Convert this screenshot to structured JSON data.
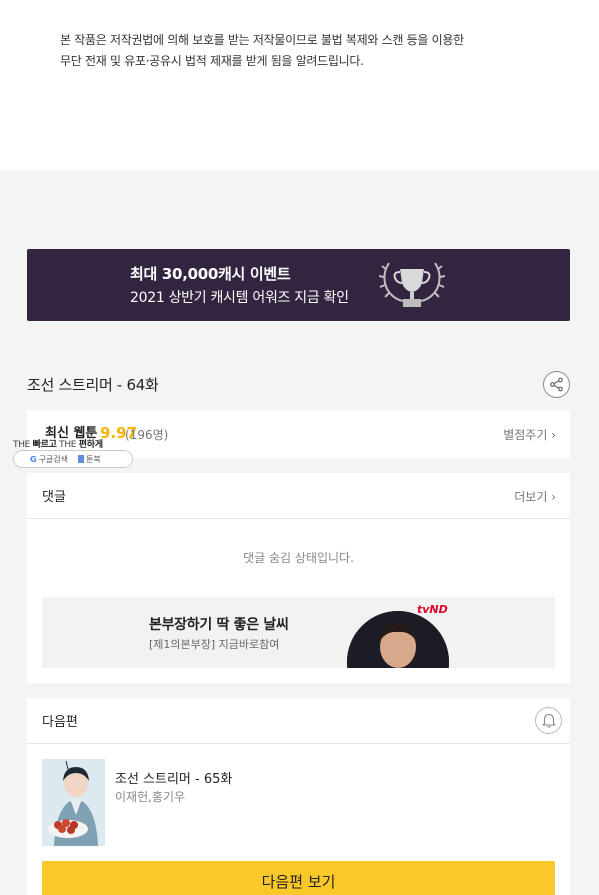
{
  "notice": {
    "line1": "본 작품은 저작권법에 의해 보호를 받는 저작물이므로 불법 복제와 스캔 등을 이용한",
    "line2": "무단 전재 및 유포·공유시 법적 제재를 받게 됨을 알려드립니다."
  },
  "banner": {
    "title": "최대 30,000캐시 이벤트",
    "subtitle": "2021 상반기 캐시템 어워즈 지금 확인",
    "background": "#33243f"
  },
  "episode": {
    "title": "조선 스트리머 - 64화"
  },
  "rating": {
    "label": "최신 웹툰",
    "score": "9.97",
    "count": "(196명)",
    "rate_link": "별점주기 ›"
  },
  "overlay_ad": {
    "text_prefix": "THE",
    "text_fast": "빠르고",
    "text_mid": "THE",
    "text_easy": "편하게",
    "google_label": "구글검색",
    "book_label": "툰북"
  },
  "comments": {
    "header": "댓글",
    "more_link": "더보기 ›",
    "hidden_message": "댓글 숨김 상태입니다.",
    "promo_title": "본부장하기 딱 좋은 날씨",
    "promo_subtitle": "[제1의본부장] 지금바로참여",
    "promo_logo": "tvND"
  },
  "next_episode": {
    "header": "다음편",
    "title": "조선 스트리머 - 65화",
    "authors": "이재헌,홍기우",
    "button_label": "다음편 보기",
    "button_color": "#fbc82a"
  },
  "icons": [
    "share-icon",
    "bell-icon",
    "trophy-icon",
    "chevron-right-icon"
  ]
}
